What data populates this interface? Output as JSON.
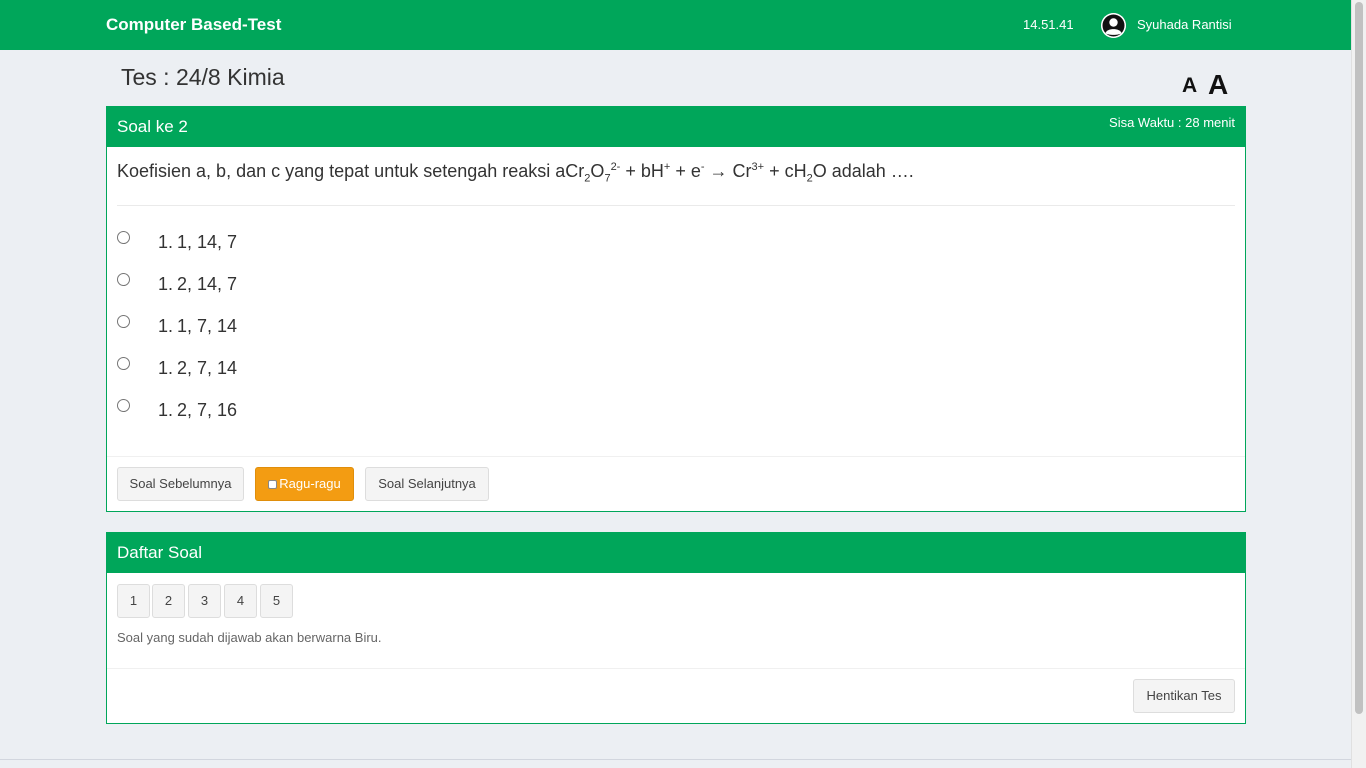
{
  "header": {
    "brand": "Computer Based-Test",
    "clock": "14.51.41",
    "username": "Syuhada Rantisi"
  },
  "page": {
    "title": "Tes : 24/8 Kimia",
    "font_small_label": "A",
    "font_large_label": "A"
  },
  "question_panel": {
    "title": "Soal ke 2",
    "timer": "Sisa Waktu : 28 menit",
    "question": {
      "part1": "Koefisien a, b, dan c yang tepat untuk setengah reaksi aCr",
      "sub1": "2",
      "part2": "O",
      "sub2": "7",
      "sup1": "2-",
      "part3": " + bH",
      "sup2": "+",
      "part4": " + e",
      "sup3": "-",
      "part5": " → Cr",
      "sup4": "3+",
      "part6": " + cH",
      "sub3": "2",
      "part7": "O adalah …."
    },
    "options": [
      {
        "number": "1.",
        "text": "1, 14, 7"
      },
      {
        "number": "1.",
        "text": "2, 14, 7"
      },
      {
        "number": "1.",
        "text": "1, 7, 14"
      },
      {
        "number": "1.",
        "text": "2, 7, 14"
      },
      {
        "number": "1.",
        "text": "2, 7, 16"
      }
    ],
    "buttons": {
      "prev": "Soal Sebelumnya",
      "doubt": "Ragu-ragu",
      "next": "Soal Selanjutnya"
    }
  },
  "list_panel": {
    "title": "Daftar Soal",
    "numbers": [
      "1",
      "2",
      "3",
      "4",
      "5"
    ],
    "note": "Soal yang sudah dijawab akan berwarna Biru.",
    "stop_button": "Hentikan Tes"
  },
  "colors": {
    "primary": "#00a65a",
    "warning": "#f39c12",
    "background": "#eceff3"
  }
}
